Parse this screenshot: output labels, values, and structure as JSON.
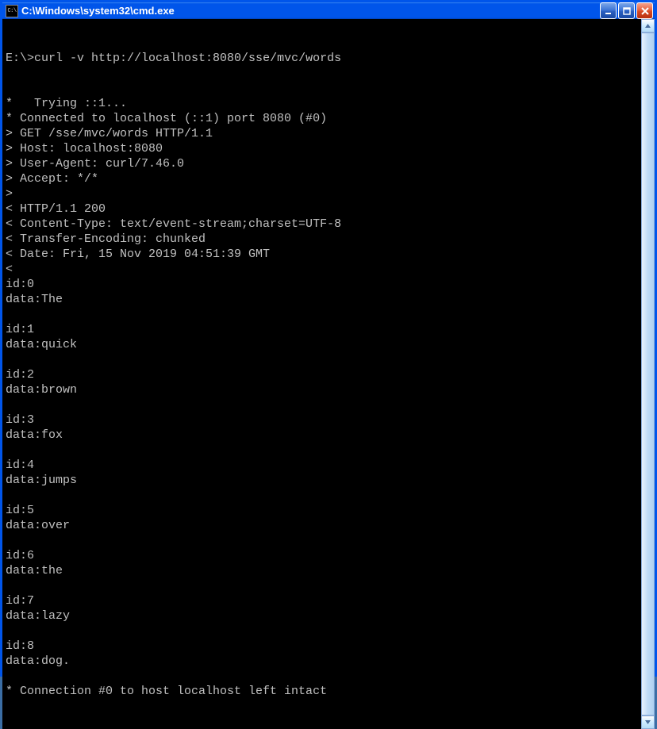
{
  "window": {
    "title": "C:\\Windows\\system32\\cmd.exe",
    "icon_label": "C:\\"
  },
  "terminal": {
    "prompt": "E:\\>",
    "command": "curl -v http://localhost:8080/sse/mvc/words",
    "lines": [
      "*   Trying ::1...",
      "* Connected to localhost (::1) port 8080 (#0)",
      "> GET /sse/mvc/words HTTP/1.1",
      "> Host: localhost:8080",
      "> User-Agent: curl/7.46.0",
      "> Accept: */*",
      ">",
      "< HTTP/1.1 200",
      "< Content-Type: text/event-stream;charset=UTF-8",
      "< Transfer-Encoding: chunked",
      "< Date: Fri, 15 Nov 2019 04:51:39 GMT",
      "<",
      "id:0",
      "data:The",
      "",
      "id:1",
      "data:quick",
      "",
      "id:2",
      "data:brown",
      "",
      "id:3",
      "data:fox",
      "",
      "id:4",
      "data:jumps",
      "",
      "id:5",
      "data:over",
      "",
      "id:6",
      "data:the",
      "",
      "id:7",
      "data:lazy",
      "",
      "id:8",
      "data:dog.",
      "",
      "* Connection #0 to host localhost left intact"
    ]
  }
}
